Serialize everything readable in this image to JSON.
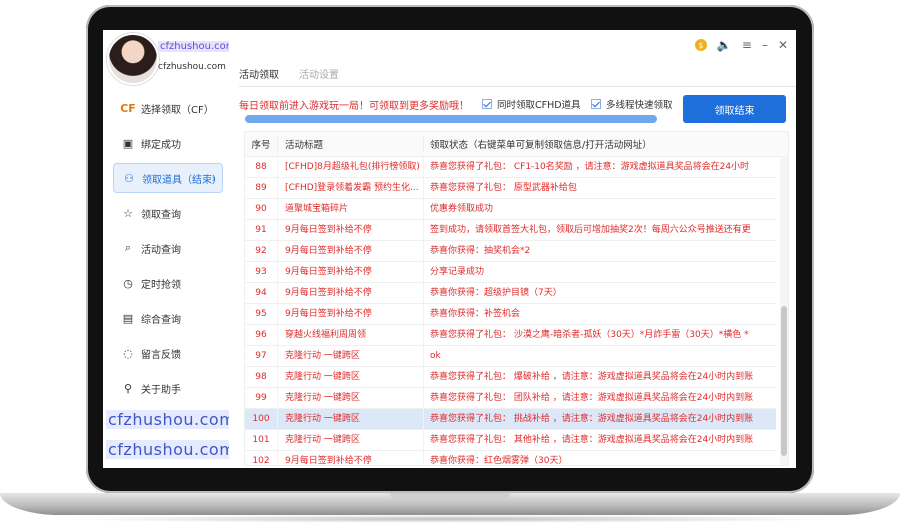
{
  "app": {
    "site_main": "cfzhushou.com",
    "site_sub": "cfzhushou.com",
    "watermark": "cfzhushou.com"
  },
  "sidebar": {
    "items": [
      {
        "label": "选择领取（CF）",
        "icon": "cf-logo-icon",
        "active": false
      },
      {
        "label": "绑定成功",
        "icon": "bind-icon",
        "active": false
      },
      {
        "label": "领取道具（结束）",
        "icon": "gift-icon",
        "active": true
      },
      {
        "label": "领取查询",
        "icon": "query-icon",
        "active": false
      },
      {
        "label": "活动查询",
        "icon": "activity-query-icon",
        "active": false
      },
      {
        "label": "定时抢领",
        "icon": "timer-icon",
        "active": false
      },
      {
        "label": "综合查询",
        "icon": "document-icon",
        "active": false
      },
      {
        "label": "留言反馈",
        "icon": "chat-icon",
        "active": false
      },
      {
        "label": "关于助手",
        "icon": "user-icon",
        "active": false
      }
    ]
  },
  "tabs": [
    {
      "label": "活动领取",
      "active": true
    },
    {
      "label": "活动设置",
      "active": false
    }
  ],
  "notice": "每日领取前进入游戏玩一局！可领取到更多奖励哦！",
  "options": {
    "sync_label": "同时领取CFHD道具",
    "multithread_label": "多线程快速领取"
  },
  "action_button": "领取结束",
  "progress": 1.0,
  "colors": {
    "accent": "#1e6fdc",
    "alert_text": "#e02b2b",
    "selected_row": "#dce8f8"
  },
  "table": {
    "headers": [
      "序号",
      "活动标题",
      "领取状态（右键菜单可复制领取信息/打开活动网址）"
    ],
    "rows": [
      {
        "no": "88",
        "title": "[CFHD]8月超级礼包(排行榜领取)",
        "status": "恭喜您获得了礼包： CF1-10名奖励 ，请注意：游戏虚拟道具奖品将会在24小时"
      },
      {
        "no": "89",
        "title": "[CFHD]登录领着发霸  预约生化...",
        "status": "恭喜您获得了礼包： 原型武器补给包"
      },
      {
        "no": "90",
        "title": "道聚城宝箱碎片",
        "status": "优惠券领取成功"
      },
      {
        "no": "91",
        "title": "9月每日签到补给不停",
        "status": "签到成功，请领取首签大礼包，领取后可增加抽奖2次！每周六公众号推送还有更"
      },
      {
        "no": "92",
        "title": "9月每日签到补给不停",
        "status": "恭喜你获得：抽奖机会*2"
      },
      {
        "no": "93",
        "title": "9月每日签到补给不停",
        "status": "分享记录成功"
      },
      {
        "no": "94",
        "title": "9月每日签到补给不停",
        "status": "恭喜你获得：超级护目镜（7天）"
      },
      {
        "no": "95",
        "title": "9月每日签到补给不停",
        "status": "恭喜你获得：补签机会"
      },
      {
        "no": "96",
        "title": "穿越火线福利周周领",
        "status": "恭喜您获得了礼包： 沙漠之鹰-暗杀者-孤妖（30天）*月詐手雷（30天）*横色 *"
      },
      {
        "no": "97",
        "title": "克隆行动 一键跨区",
        "status": "ok"
      },
      {
        "no": "98",
        "title": "克隆行动 一键跨区",
        "status": "恭喜您获得了礼包： 爆破补给 ，请注意：游戏虚拟道具奖品将会在24小时内到账"
      },
      {
        "no": "99",
        "title": "克隆行动 一键跨区",
        "status": "恭喜您获得了礼包： 团队补给 ，请注意：游戏虚拟道具奖品将会在24小时内到账"
      },
      {
        "no": "100",
        "title": "克隆行动 一键跨区",
        "status": "恭喜您获得了礼包： 挑战补给 ，请注意：游戏虚拟道具奖品将会在24小时内到账",
        "selected": true
      },
      {
        "no": "101",
        "title": "克隆行动 一键跨区",
        "status": "恭喜您获得了礼包： 其他补给 ，请注意：游戏虚拟道具奖品将会在24小时内到账"
      },
      {
        "no": "102",
        "title": "9月每日签到补给不停",
        "status": "恭喜你获得：红色烟雾弹（30天）"
      }
    ]
  }
}
